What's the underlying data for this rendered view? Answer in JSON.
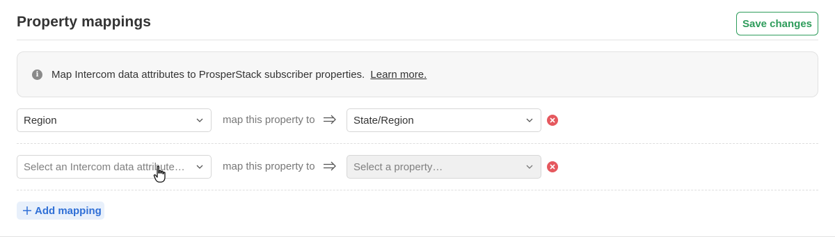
{
  "header": {
    "title": "Property mappings",
    "save_label": "Save changes"
  },
  "info": {
    "icon": "info-icon",
    "text": "Map Intercom data attributes to ProsperStack subscriber properties.",
    "link_text": "Learn more."
  },
  "mappings": [
    {
      "source_value": "Region",
      "map_label": "map this property to",
      "target_value": "State/Region"
    },
    {
      "source_placeholder": "Select an Intercom data attribute…",
      "map_label": "map this property to",
      "target_placeholder": "Select a property…"
    }
  ],
  "add_mapping_label": "Add mapping",
  "colors": {
    "accent_green": "#2e9c5b",
    "remove_red": "#e5585e",
    "link_blue": "#2f6fd6"
  }
}
